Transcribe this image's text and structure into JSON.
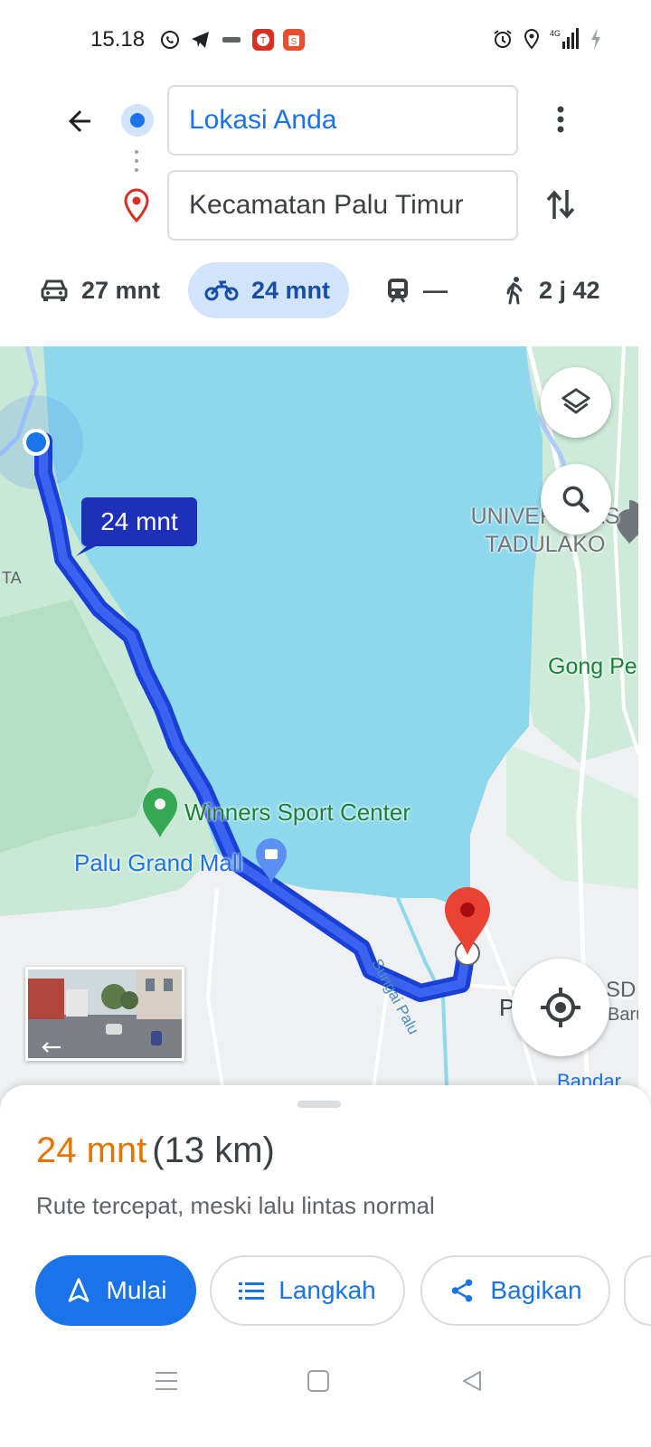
{
  "status_bar": {
    "time": "15.18",
    "network": "4G"
  },
  "header": {
    "origin": "Lokasi Anda",
    "destination": "Kecamatan Palu Timur"
  },
  "modes": [
    {
      "name": "car",
      "icon": "car-icon",
      "label": "27 mnt"
    },
    {
      "name": "motorcycle",
      "icon": "motorcycle-icon",
      "label": "24 mnt",
      "selected": true
    },
    {
      "name": "transit",
      "icon": "train-icon",
      "label": "—"
    },
    {
      "name": "walk",
      "icon": "walk-icon",
      "label": "2 j 42"
    }
  ],
  "map": {
    "eta_bubble": "24 mnt",
    "labels": {
      "university": "UNIVERSITAS\nTADULAKO",
      "gong": "Gong Pe",
      "winners": "Winners Sport Center",
      "mall": "Palu Grand Mall",
      "river": "Sungai Palu",
      "sd": "SD",
      "baru": "Baru",
      "bandar": "Bandar",
      "ta": "TA",
      "p": "P"
    }
  },
  "route": {
    "duration": "24 mnt",
    "distance": "(13 km)",
    "description": "Rute tercepat, meski lalu lintas normal"
  },
  "actions": {
    "start": "Mulai",
    "steps": "Langkah",
    "share": "Bagikan"
  },
  "colors": {
    "accent": "#1a73e8",
    "route": "#1a3fd6",
    "duration": "#e37400",
    "water": "#8ed8ec",
    "destination_pin": "#ea4335"
  }
}
